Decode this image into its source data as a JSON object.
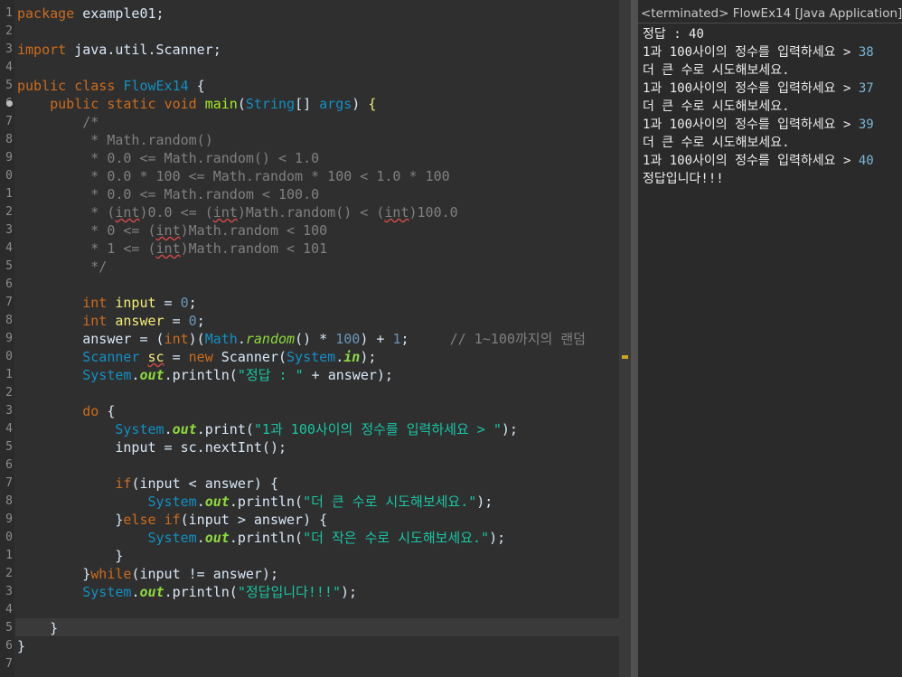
{
  "editor": {
    "line_numbers": [
      "1",
      "2",
      "3",
      "4",
      "5",
      "6",
      "7",
      "8",
      "9",
      "0",
      "1",
      "2",
      "3",
      "4",
      "5",
      "6",
      "7",
      "8",
      "9",
      "0",
      "1",
      "2",
      "3",
      "4",
      "5",
      "6",
      "7",
      "8",
      "9",
      "0",
      "1",
      "2",
      "3",
      "4",
      "5",
      "6",
      "7"
    ],
    "lines": [
      [
        {
          "t": "package",
          "c": "kw"
        },
        {
          "t": " example01;",
          "c": "plain"
        }
      ],
      [],
      [
        {
          "t": "import",
          "c": "kw"
        },
        {
          "t": " java.util.Scanner;",
          "c": "plain"
        }
      ],
      [],
      [
        {
          "t": "public",
          "c": "kw"
        },
        {
          "t": " ",
          "c": "plain"
        },
        {
          "t": "class",
          "c": "kw"
        },
        {
          "t": " ",
          "c": "plain"
        },
        {
          "t": "FlowEx14",
          "c": "cls"
        },
        {
          "t": " {",
          "c": "plain"
        }
      ],
      [
        {
          "t": "    ",
          "c": "plain"
        },
        {
          "t": "public",
          "c": "kw"
        },
        {
          "t": " ",
          "c": "plain"
        },
        {
          "t": "static",
          "c": "kw"
        },
        {
          "t": " ",
          "c": "plain"
        },
        {
          "t": "void",
          "c": "kw"
        },
        {
          "t": " ",
          "c": "plain"
        },
        {
          "t": "main",
          "c": "fn"
        },
        {
          "t": "(",
          "c": "plain"
        },
        {
          "t": "String",
          "c": "type"
        },
        {
          "t": "[] ",
          "c": "plain"
        },
        {
          "t": "args",
          "c": "type"
        },
        {
          "t": ") ",
          "c": "plain"
        },
        {
          "t": "{",
          "c": "var"
        }
      ],
      [
        {
          "t": "        /*",
          "c": "cm"
        }
      ],
      [
        {
          "t": "         * Math.random()",
          "c": "cm"
        }
      ],
      [
        {
          "t": "         * 0.0 <= Math.random() < 1.0",
          "c": "cm"
        }
      ],
      [
        {
          "t": "         * 0.0 * 100 <= Math.random * 100 < 1.0 * 100",
          "c": "cm"
        }
      ],
      [
        {
          "t": "         * 0.0 <= Math.random < 100.0",
          "c": "cm"
        }
      ],
      [
        {
          "t": "         * (",
          "c": "cm"
        },
        {
          "t": "int",
          "c": "cm squig"
        },
        {
          "t": ")0.0 <= (",
          "c": "cm"
        },
        {
          "t": "int",
          "c": "cm squig"
        },
        {
          "t": ")Math.random() < (",
          "c": "cm"
        },
        {
          "t": "int",
          "c": "cm squig"
        },
        {
          "t": ")100.0",
          "c": "cm"
        }
      ],
      [
        {
          "t": "         * 0 <= (",
          "c": "cm"
        },
        {
          "t": "int",
          "c": "cm squig"
        },
        {
          "t": ")Math.random < 100",
          "c": "cm"
        }
      ],
      [
        {
          "t": "         * 1 <= (",
          "c": "cm"
        },
        {
          "t": "int",
          "c": "cm squig"
        },
        {
          "t": ")Math.random < 101",
          "c": "cm"
        }
      ],
      [
        {
          "t": "         */",
          "c": "cm"
        }
      ],
      [],
      [
        {
          "t": "        ",
          "c": "plain"
        },
        {
          "t": "int",
          "c": "kw"
        },
        {
          "t": " ",
          "c": "plain"
        },
        {
          "t": "input",
          "c": "var"
        },
        {
          "t": " = ",
          "c": "plain"
        },
        {
          "t": "0",
          "c": "num"
        },
        {
          "t": ";",
          "c": "plain"
        }
      ],
      [
        {
          "t": "        ",
          "c": "plain"
        },
        {
          "t": "int",
          "c": "kw"
        },
        {
          "t": " ",
          "c": "plain"
        },
        {
          "t": "answer",
          "c": "var"
        },
        {
          "t": " = ",
          "c": "plain"
        },
        {
          "t": "0",
          "c": "num"
        },
        {
          "t": ";",
          "c": "plain"
        }
      ],
      [
        {
          "t": "        answer = (",
          "c": "plain"
        },
        {
          "t": "int",
          "c": "kw"
        },
        {
          "t": ")(",
          "c": "plain"
        },
        {
          "t": "Math",
          "c": "type"
        },
        {
          "t": ".",
          "c": "plain"
        },
        {
          "t": "random",
          "c": "stat"
        },
        {
          "t": "() * ",
          "c": "plain"
        },
        {
          "t": "100",
          "c": "num"
        },
        {
          "t": ") + ",
          "c": "plain"
        },
        {
          "t": "1",
          "c": "num"
        },
        {
          "t": ";     ",
          "c": "plain"
        },
        {
          "t": "// 1~100까지의 랜덤",
          "c": "cm"
        }
      ],
      [
        {
          "t": "        ",
          "c": "plain"
        },
        {
          "t": "Scanner",
          "c": "type"
        },
        {
          "t": " ",
          "c": "plain"
        },
        {
          "t": "sc",
          "c": "var squig"
        },
        {
          "t": " = ",
          "c": "plain"
        },
        {
          "t": "new",
          "c": "kw"
        },
        {
          "t": " ",
          "c": "plain"
        },
        {
          "t": "Scanner",
          "c": "plain"
        },
        {
          "t": "(",
          "c": "plain"
        },
        {
          "t": "System",
          "c": "type"
        },
        {
          "t": ".",
          "c": "plain"
        },
        {
          "t": "in",
          "c": "field"
        },
        {
          "t": ");",
          "c": "plain"
        }
      ],
      [
        {
          "t": "        ",
          "c": "plain"
        },
        {
          "t": "System",
          "c": "type"
        },
        {
          "t": ".",
          "c": "plain"
        },
        {
          "t": "out",
          "c": "field"
        },
        {
          "t": ".println(",
          "c": "plain"
        },
        {
          "t": "\"정답 : \"",
          "c": "str"
        },
        {
          "t": " + answer);",
          "c": "plain"
        }
      ],
      [],
      [
        {
          "t": "        ",
          "c": "plain"
        },
        {
          "t": "do",
          "c": "kw"
        },
        {
          "t": " {",
          "c": "plain"
        }
      ],
      [
        {
          "t": "            ",
          "c": "plain"
        },
        {
          "t": "System",
          "c": "type"
        },
        {
          "t": ".",
          "c": "plain"
        },
        {
          "t": "out",
          "c": "field"
        },
        {
          "t": ".print(",
          "c": "plain"
        },
        {
          "t": "\"1과 100사이의 정수를 입력하세요 > \"",
          "c": "str"
        },
        {
          "t": ");",
          "c": "plain"
        }
      ],
      [
        {
          "t": "            input = sc.nextInt();",
          "c": "plain"
        }
      ],
      [],
      [
        {
          "t": "            ",
          "c": "plain"
        },
        {
          "t": "if",
          "c": "kw"
        },
        {
          "t": "(input < answer) {",
          "c": "plain"
        }
      ],
      [
        {
          "t": "                ",
          "c": "plain"
        },
        {
          "t": "System",
          "c": "type"
        },
        {
          "t": ".",
          "c": "plain"
        },
        {
          "t": "out",
          "c": "field"
        },
        {
          "t": ".println(",
          "c": "plain"
        },
        {
          "t": "\"더 큰 수로 시도해보세요.\"",
          "c": "str"
        },
        {
          "t": ");",
          "c": "plain"
        }
      ],
      [
        {
          "t": "            }",
          "c": "plain"
        },
        {
          "t": "else",
          "c": "kw"
        },
        {
          "t": " ",
          "c": "plain"
        },
        {
          "t": "if",
          "c": "kw"
        },
        {
          "t": "(input > answer) {",
          "c": "plain"
        }
      ],
      [
        {
          "t": "                ",
          "c": "plain"
        },
        {
          "t": "System",
          "c": "type"
        },
        {
          "t": ".",
          "c": "plain"
        },
        {
          "t": "out",
          "c": "field"
        },
        {
          "t": ".println(",
          "c": "plain"
        },
        {
          "t": "\"더 작은 수로 시도해보세요.\"",
          "c": "str"
        },
        {
          "t": ");",
          "c": "plain"
        }
      ],
      [
        {
          "t": "            }",
          "c": "plain"
        }
      ],
      [
        {
          "t": "        }",
          "c": "plain"
        },
        {
          "t": "while",
          "c": "kw"
        },
        {
          "t": "(input != answer);",
          "c": "plain"
        }
      ],
      [
        {
          "t": "        ",
          "c": "plain"
        },
        {
          "t": "System",
          "c": "type"
        },
        {
          "t": ".",
          "c": "plain"
        },
        {
          "t": "out",
          "c": "field"
        },
        {
          "t": ".println(",
          "c": "plain"
        },
        {
          "t": "\"정답입니다!!!\"",
          "c": "str"
        },
        {
          "t": ");",
          "c": "plain"
        }
      ],
      [],
      [
        {
          "t": "    }",
          "c": "plain"
        }
      ],
      [
        {
          "t": "}",
          "c": "plain"
        }
      ],
      []
    ]
  },
  "console": {
    "header": "<terminated> FlowEx14 [Java Application]",
    "lines": [
      [
        {
          "t": "정답 : 40",
          "c": "out"
        }
      ],
      [
        {
          "t": "1과 100사이의 정수를 입력하세요 > ",
          "c": "out"
        },
        {
          "t": "38",
          "c": "in"
        }
      ],
      [
        {
          "t": "더 큰 수로 시도해보세요.",
          "c": "out"
        }
      ],
      [
        {
          "t": "1과 100사이의 정수를 입력하세요 > ",
          "c": "out"
        },
        {
          "t": "37",
          "c": "in"
        }
      ],
      [
        {
          "t": "더 큰 수로 시도해보세요.",
          "c": "out"
        }
      ],
      [
        {
          "t": "1과 100사이의 정수를 입력하세요 > ",
          "c": "out"
        },
        {
          "t": "39",
          "c": "in"
        }
      ],
      [
        {
          "t": "더 큰 수로 시도해보세요.",
          "c": "out"
        }
      ],
      [
        {
          "t": "1과 100사이의 정수를 입력하세요 > ",
          "c": "out"
        },
        {
          "t": "40",
          "c": "in"
        }
      ],
      [
        {
          "t": "정답입니다!!!",
          "c": "out"
        }
      ]
    ]
  }
}
